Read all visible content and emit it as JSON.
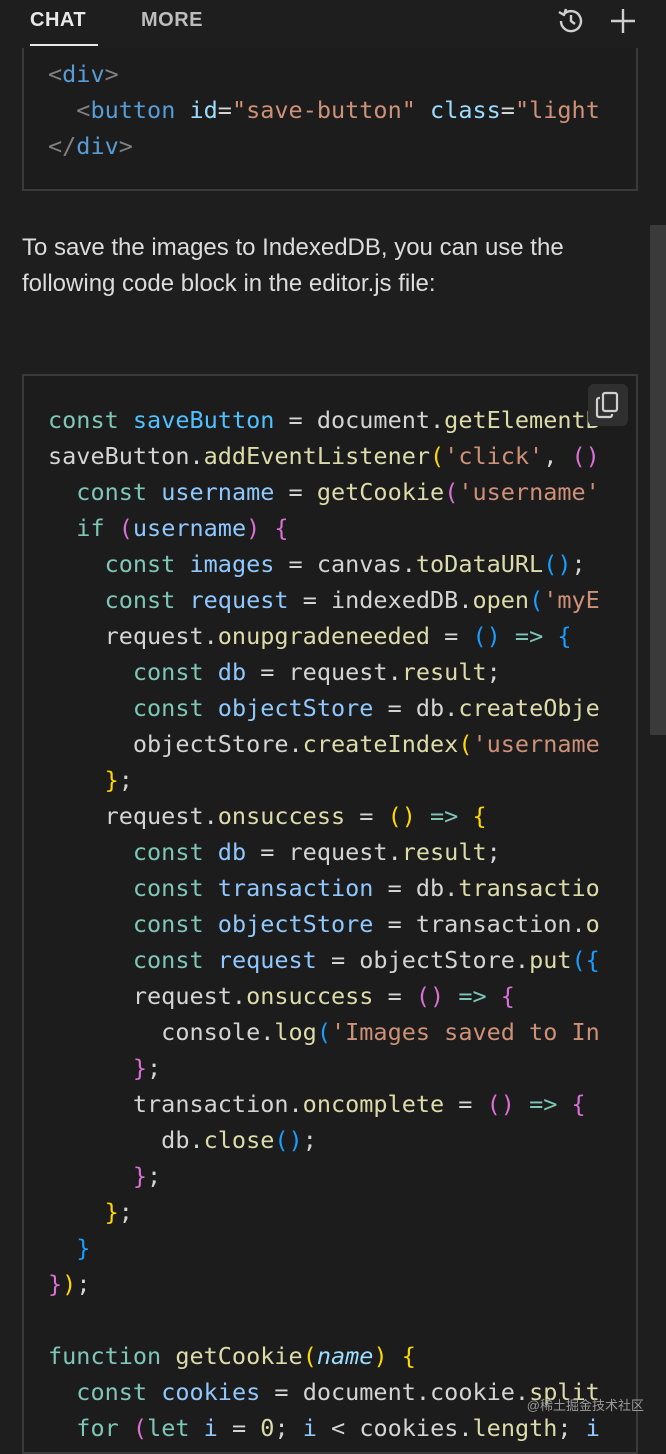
{
  "tabs": {
    "chat_label": "CHAT",
    "more_label": "MORE"
  },
  "icons": {
    "history": "history-icon",
    "new": "plus-icon",
    "copy": "copy-icon"
  },
  "prose": {
    "text": "To save the images to IndexedDB, you can use the following code block in the editor.js file:"
  },
  "html_snippet": {
    "line1": "<div>",
    "line2_tag_open": "<button",
    "line2_attr1": "id",
    "line2_val1": "\"save-button\"",
    "line2_attr2": "class",
    "line2_val2": "\"light",
    "line3": "</div>"
  },
  "watermark": "@稀土掘金技术社区"
}
